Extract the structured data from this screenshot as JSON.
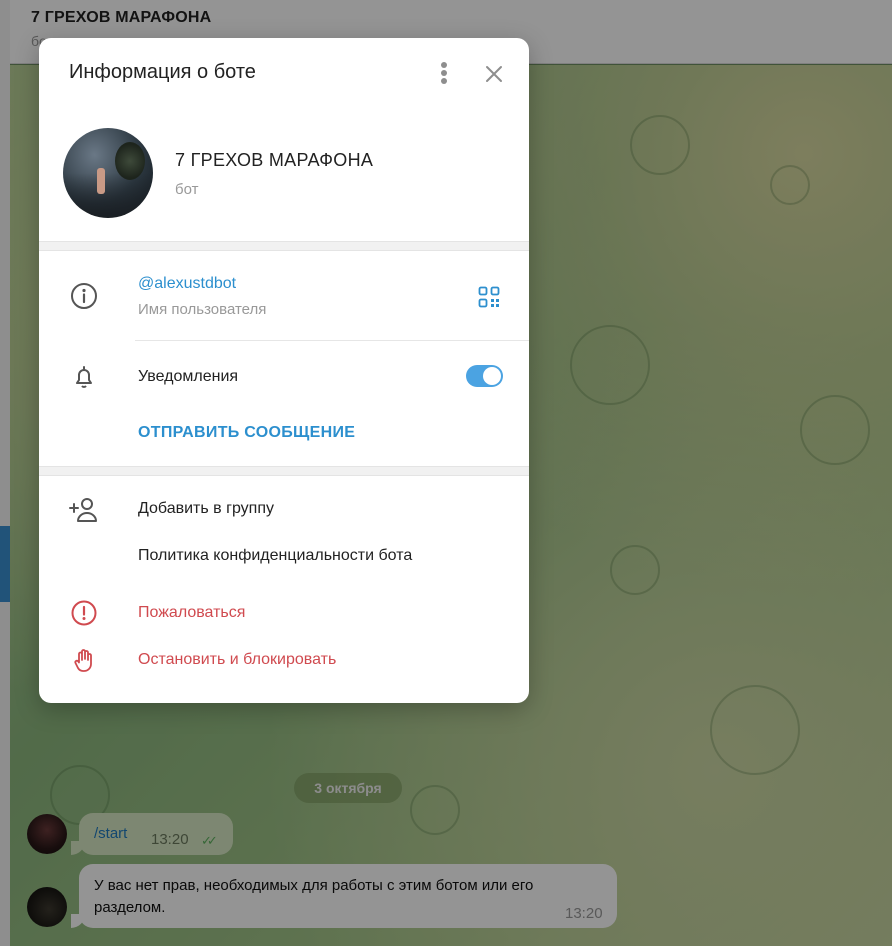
{
  "chat": {
    "title": "7 ГРЕХОВ МАРАФОНА",
    "subtitle": "бот",
    "date_separator": "3 октября",
    "messages": [
      {
        "direction": "out",
        "text": "/start",
        "time": "13:20",
        "status": "read"
      },
      {
        "direction": "in",
        "text": "У вас нет прав, необходимых для работы с этим ботом или его разделом.",
        "time": "13:20"
      }
    ]
  },
  "modal": {
    "title": "Информация о боте",
    "profile": {
      "name": "7 ГРЕХОВ МАРАФОНА",
      "subtitle": "бот"
    },
    "username": {
      "value": "@alexustdbot",
      "label": "Имя пользователя"
    },
    "notifications": {
      "label": "Уведомления",
      "enabled": true
    },
    "send_message_label": "ОТПРАВИТЬ СООБЩЕНИЕ",
    "actions": {
      "add_to_group": "Добавить в группу",
      "privacy_policy": "Политика конфиденциальности бота",
      "report": "Пожаловаться",
      "stop_and_block": "Остановить и блокировать"
    }
  },
  "colors": {
    "accent": "#2c8fce",
    "danger": "#d04a4f",
    "toggle_on": "#4ba3e2"
  }
}
